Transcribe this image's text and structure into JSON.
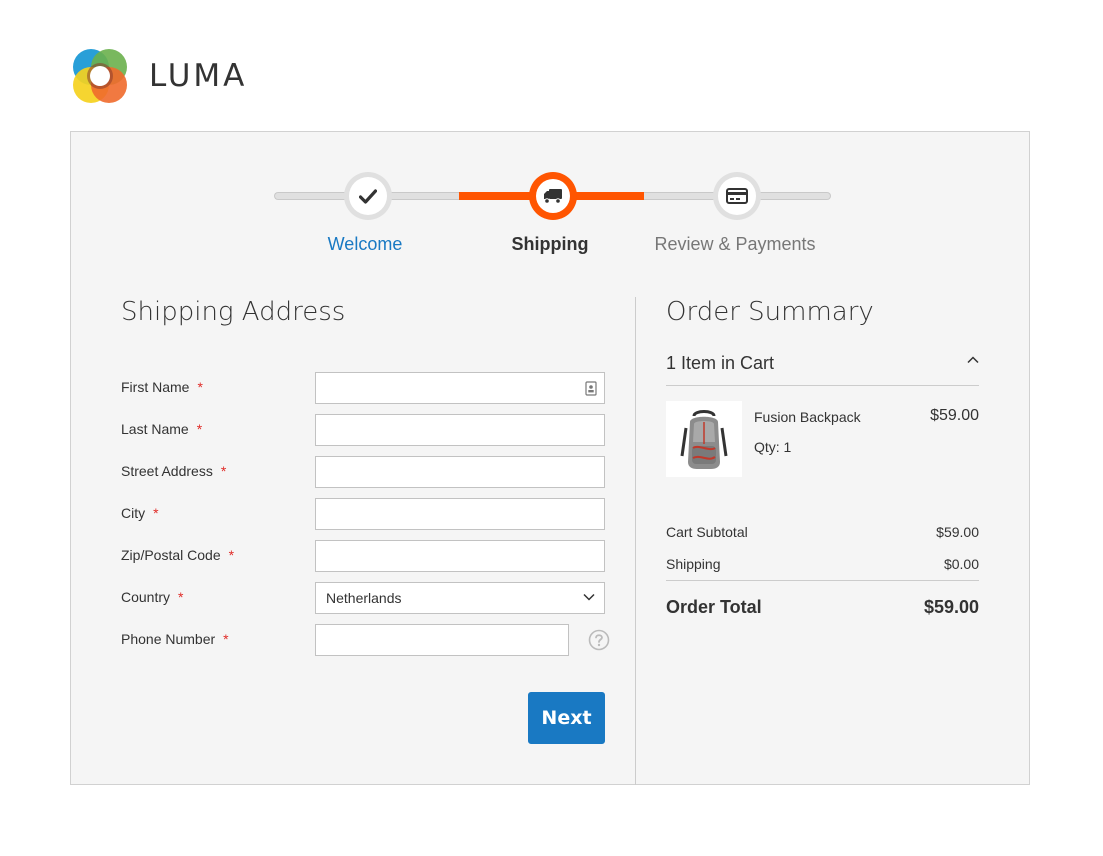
{
  "brand": {
    "name": "LUMA"
  },
  "progress": {
    "steps": [
      {
        "label": "Welcome",
        "state": "complete",
        "icon": "checkmark-icon"
      },
      {
        "label": "Shipping",
        "state": "current",
        "icon": "truck-icon"
      },
      {
        "label": "Review & Payments",
        "state": "upcoming",
        "icon": "credit-card-icon"
      }
    ],
    "accent": "#ff5501",
    "link_color": "#1979c3"
  },
  "shipping": {
    "title": "Shipping Address",
    "fields": [
      {
        "label": "First Name",
        "required": "*",
        "value": ""
      },
      {
        "label": "Last Name",
        "required": "*",
        "value": ""
      },
      {
        "label": "Street Address",
        "required": "*",
        "value": ""
      },
      {
        "label": "City",
        "required": "*",
        "value": ""
      },
      {
        "label": "Zip/Postal Code",
        "required": "*",
        "value": ""
      },
      {
        "label": "Country",
        "required": "*",
        "value": "Netherlands"
      },
      {
        "label": "Phone Number",
        "required": "*",
        "value": ""
      }
    ],
    "next_label": "Next",
    "button_color": "#1979c3"
  },
  "summary": {
    "title": "Order Summary",
    "cart_count": "1 Item in Cart",
    "items": [
      {
        "name": "Fusion Backpack",
        "qty": "Qty: 1",
        "price": "$59.00"
      }
    ],
    "subtotal_label": "Cart Subtotal",
    "subtotal_value": "$59.00",
    "shipping_label": "Shipping",
    "shipping_value": "$0.00",
    "total_label": "Order Total",
    "total_value": "$59.00"
  }
}
